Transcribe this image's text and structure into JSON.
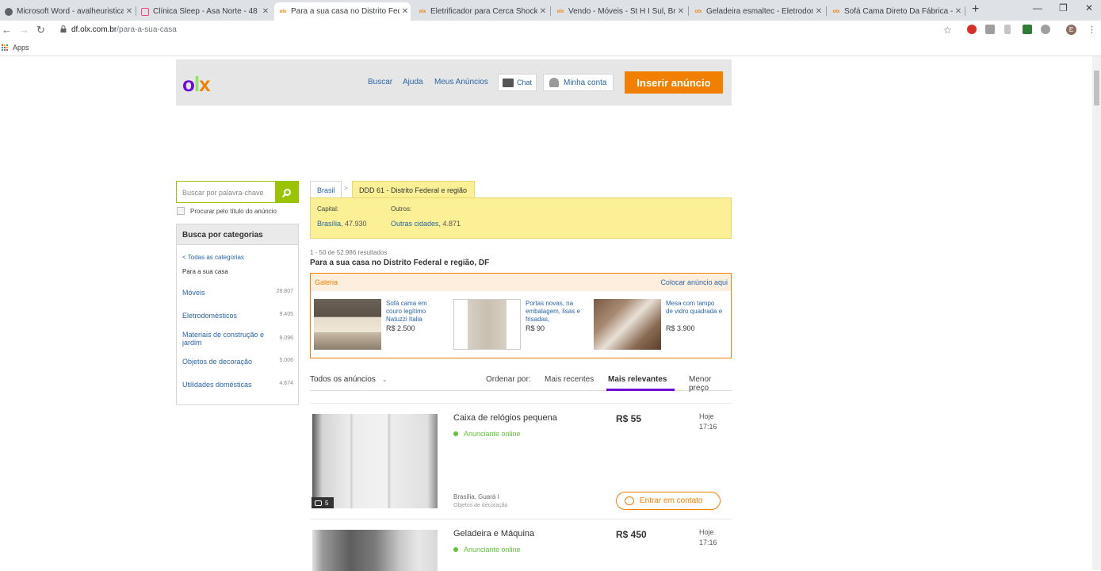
{
  "browser": {
    "tabs": [
      {
        "title": "Microsoft Word - avalheuristica_I",
        "icon": "chrome-icon",
        "color": "#5f6368"
      },
      {
        "title": "Clínica Sleep - Asa Norte - 48 cli",
        "icon": "foursquare-icon",
        "color": "#f94877"
      },
      {
        "title": "Para a sua casa no Distrito Feder",
        "icon": "olx-icon",
        "color": "#f28000"
      },
      {
        "title": "Eletrificador para Cerca Shock 8",
        "icon": "olx-icon",
        "color": "#f28000"
      },
      {
        "title": "Vendo - Móveis - St H I Sul, Brasi",
        "icon": "olx-icon",
        "color": "#f28000"
      },
      {
        "title": "Geladeira esmaltec - Eletrodomé",
        "icon": "olx-icon",
        "color": "#f28000"
      },
      {
        "title": "Sofá Cama Direto Da Fábrica - M",
        "icon": "olx-icon",
        "color": "#f28000"
      }
    ],
    "url_host": "df.olx.com.br",
    "url_path": "/para-a-sua-casa",
    "bookmarks_apps": "Apps",
    "profile_initial": "E"
  },
  "header": {
    "nav": [
      "Buscar",
      "Ajuda",
      "Meus Anúncios"
    ],
    "chat": "Chat",
    "account": "Minha conta",
    "insert": "Inserir anúncio"
  },
  "sidebar": {
    "search_placeholder": "Buscar por palavra-chave",
    "title_only": "Procurar pelo título do anúncio",
    "categories_title": "Busca por categorias",
    "all_categories": "< Todas as categorias",
    "current": "Para a sua casa",
    "items": [
      {
        "label": "Móveis",
        "count": "28.807"
      },
      {
        "label": "Eletrodomésticos",
        "count": "9.405"
      },
      {
        "label": "Materiais de construção e jardim",
        "count": "9.096"
      },
      {
        "label": "Objetos de decoração",
        "count": "5.006"
      },
      {
        "label": "Utilidades domésticas",
        "count": "4.674"
      }
    ]
  },
  "location": {
    "crumb_brasil": "Brasil",
    "crumb_sep": ">",
    "crumb_ddd": "DDD 61 - Distrito Federal e região",
    "capital_label": "Capital:",
    "capital_name": "Brasília",
    "capital_count": ", 47.930",
    "others_label": "Outros:",
    "others_name": "Outras cidades",
    "others_count": ", 4.871"
  },
  "results": {
    "count": "1 - 50 de 52.986 resultados",
    "title": "Para a sua casa no Distrito Federal e região, DF"
  },
  "gallery": {
    "title": "Galeria",
    "place_ad": "Colocar anúncio aqui",
    "items": [
      {
        "text": "Sofá cama em couro legítimo Natuzzi Italia",
        "price": "R$ 2.500"
      },
      {
        "text": "Portas novas, na embalagem, lisas e frisadas,",
        "price": "R$ 90"
      },
      {
        "text": "Mesa com tampo de vidro quadrada e",
        "price": "R$ 3.900"
      }
    ]
  },
  "sort": {
    "all_ads": "Todos os anúncios",
    "order_by": "Ordenar por:",
    "recent": "Mais recentes",
    "relevant": "Mais relevantes",
    "lowest": "Menor preço"
  },
  "listings": [
    {
      "title": "Caixa de relógios pequena",
      "online": "Anunciante online",
      "price": "R$ 55",
      "date": "Hoje",
      "time": "17:16",
      "photos": "5",
      "location": "Brasília, Guará I",
      "category": "Objetos de decoração",
      "contact": "Entrar em contato"
    },
    {
      "title": "Geladeira e Máquina",
      "online": "Anunciante online",
      "price": "R$ 450",
      "date": "Hoje",
      "time": "17:16"
    }
  ]
}
